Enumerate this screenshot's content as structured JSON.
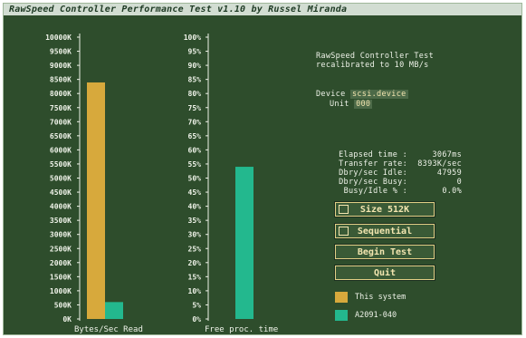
{
  "window": {
    "title": "RawSpeed Controller Performance Test v1.10 by Russel Miranda"
  },
  "header": {
    "line1": "RawSpeed Controller Test",
    "line2": "recalibrated to 10 MB/s"
  },
  "device": {
    "device_label": "Device",
    "device_value": "scsi.device",
    "unit_label": "Unit",
    "unit_value": "000"
  },
  "stats": [
    {
      "label": "Elapsed time :",
      "value": "3067ms"
    },
    {
      "label": "Transfer rate:",
      "value": "8393K/sec"
    },
    {
      "label": "Dbry/sec Idle:",
      "value": "47959"
    },
    {
      "label": "Dbry/sec Busy:",
      "value": "0"
    },
    {
      "label": "Busy/Idle % :",
      "value": "0.0%"
    }
  ],
  "buttons": {
    "size_label": "Size    512K",
    "mode_label": "Sequential",
    "begin_label": "Begin Test",
    "quit_label": "Quit"
  },
  "legend": [
    {
      "label": "This system",
      "color": "#d7a93c"
    },
    {
      "label": "A2091-040",
      "color": "#23b88e"
    }
  ],
  "colors": {
    "background": "#2e4d2c",
    "this_system": "#d7a93c",
    "reference": "#23b88e",
    "text": "#eef2e8",
    "button_border": "#e2cf86"
  },
  "chart_data": [
    {
      "type": "bar",
      "xlabel": "Bytes/Sec Read",
      "ylim": [
        0,
        10000
      ],
      "y_ticks": [
        "0K",
        "500K",
        "1000K",
        "1500K",
        "2000K",
        "2500K",
        "3000K",
        "3500K",
        "4000K",
        "4500K",
        "5000K",
        "5500K",
        "6000K",
        "6500K",
        "7000K",
        "7500K",
        "8000K",
        "8500K",
        "9000K",
        "9500K",
        "10000K"
      ],
      "series": [
        {
          "name": "This system",
          "value": 8393,
          "color": "#d7a93c"
        },
        {
          "name": "A2091-040",
          "value": 600,
          "color": "#23b88e"
        }
      ]
    },
    {
      "type": "bar",
      "xlabel": "Free proc. time",
      "ylim": [
        0,
        100
      ],
      "y_ticks": [
        "0%",
        "5%",
        "10%",
        "15%",
        "20%",
        "25%",
        "30%",
        "35%",
        "40%",
        "45%",
        "50%",
        "55%",
        "60%",
        "65%",
        "70%",
        "75%",
        "80%",
        "85%",
        "90%",
        "95%",
        "100%"
      ],
      "series": [
        {
          "name": "This system",
          "value": 0,
          "color": "#d7a93c"
        },
        {
          "name": "A2091-040",
          "value": 54,
          "color": "#23b88e"
        }
      ]
    }
  ]
}
